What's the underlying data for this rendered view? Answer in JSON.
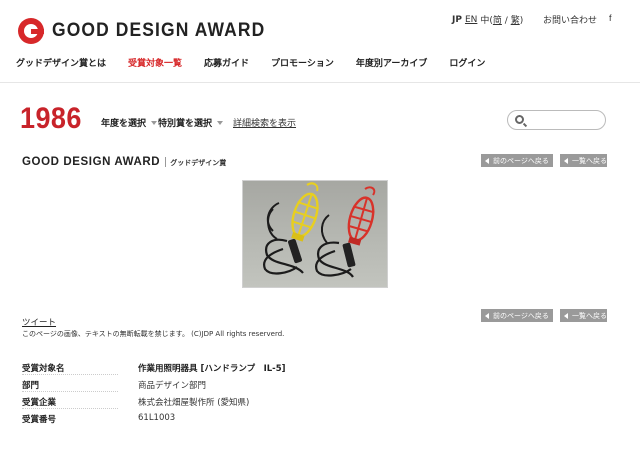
{
  "header": {
    "logo_text": "GOOD DESIGN AWARD",
    "lang": {
      "jp": "JP",
      "en": "EN",
      "zh": "中(",
      "zh_simplified": "简",
      "slash": "/",
      "zh_traditional": "繁",
      "close": ")"
    },
    "contact": "お問い合わせ",
    "facebook": "f"
  },
  "nav": {
    "items": [
      {
        "label": "グッドデザイン賞とは",
        "active": false
      },
      {
        "label": "受賞対象一覧",
        "active": true
      },
      {
        "label": "応募ガイド",
        "active": false
      },
      {
        "label": "プロモーション",
        "active": false
      },
      {
        "label": "年度別アーカイブ",
        "active": false
      },
      {
        "label": "ログイン",
        "active": false
      }
    ]
  },
  "filter": {
    "year": "1986",
    "year_select": "年度を選択",
    "special_select": "特別賞を選択",
    "advanced_search": "詳細検索を表示",
    "search_placeholder": ""
  },
  "section": {
    "title": "GOOD DESIGN AWARD",
    "subtitle": "グッドデザイン賞",
    "prev_button": "前のページへ戻る",
    "list_button": "一覧へ戻る"
  },
  "footer_note": {
    "tweet": "ツイート",
    "copyright": "このページの画像、テキストの無断転載を禁じます。 (C)JDP All rights reserverd."
  },
  "info": [
    {
      "key": "受賞対象名",
      "value": "作業用照明器具 [ハンドランプ　IL-5]"
    },
    {
      "key": "部門",
      "value": "商品デザイン部門"
    },
    {
      "key": "受賞企業",
      "value": "株式会社畑屋製作所 (愛知県)"
    },
    {
      "key": "受賞番号",
      "value": "61L1003"
    }
  ],
  "colors": {
    "brand_red": "#d7282a",
    "year_red": "#c8232a",
    "button_gray": "#9a9a9a",
    "lamp_yellow": "#e8cf1f",
    "lamp_red": "#d8322a"
  }
}
